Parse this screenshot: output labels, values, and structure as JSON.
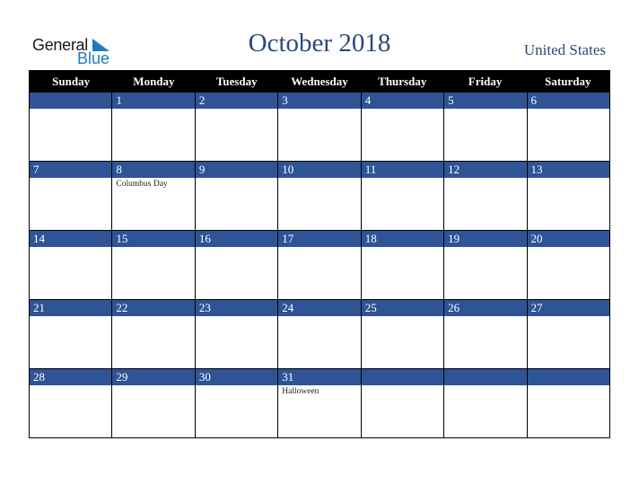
{
  "logo": {
    "line1": "General",
    "line2": "Blue"
  },
  "title": "October 2018",
  "country": "United States",
  "weekdays": [
    "Sunday",
    "Monday",
    "Tuesday",
    "Wednesday",
    "Thursday",
    "Friday",
    "Saturday"
  ],
  "weeks": [
    [
      {
        "d": ""
      },
      {
        "d": "1"
      },
      {
        "d": "2"
      },
      {
        "d": "3"
      },
      {
        "d": "4"
      },
      {
        "d": "5"
      },
      {
        "d": "6"
      }
    ],
    [
      {
        "d": "7"
      },
      {
        "d": "8",
        "h": "Columbus Day"
      },
      {
        "d": "9"
      },
      {
        "d": "10"
      },
      {
        "d": "11"
      },
      {
        "d": "12"
      },
      {
        "d": "13"
      }
    ],
    [
      {
        "d": "14"
      },
      {
        "d": "15"
      },
      {
        "d": "16"
      },
      {
        "d": "17"
      },
      {
        "d": "18"
      },
      {
        "d": "19"
      },
      {
        "d": "20"
      }
    ],
    [
      {
        "d": "21"
      },
      {
        "d": "22"
      },
      {
        "d": "23"
      },
      {
        "d": "24"
      },
      {
        "d": "25"
      },
      {
        "d": "26"
      },
      {
        "d": "27"
      }
    ],
    [
      {
        "d": "28"
      },
      {
        "d": "29"
      },
      {
        "d": "30"
      },
      {
        "d": "31",
        "h": "Halloween"
      },
      {
        "d": ""
      },
      {
        "d": ""
      },
      {
        "d": ""
      }
    ]
  ],
  "colors": {
    "header_bg": "#000000",
    "day_bar": "#2e5496",
    "title": "#2b4a7a",
    "brand_blue": "#1f7bc1"
  }
}
